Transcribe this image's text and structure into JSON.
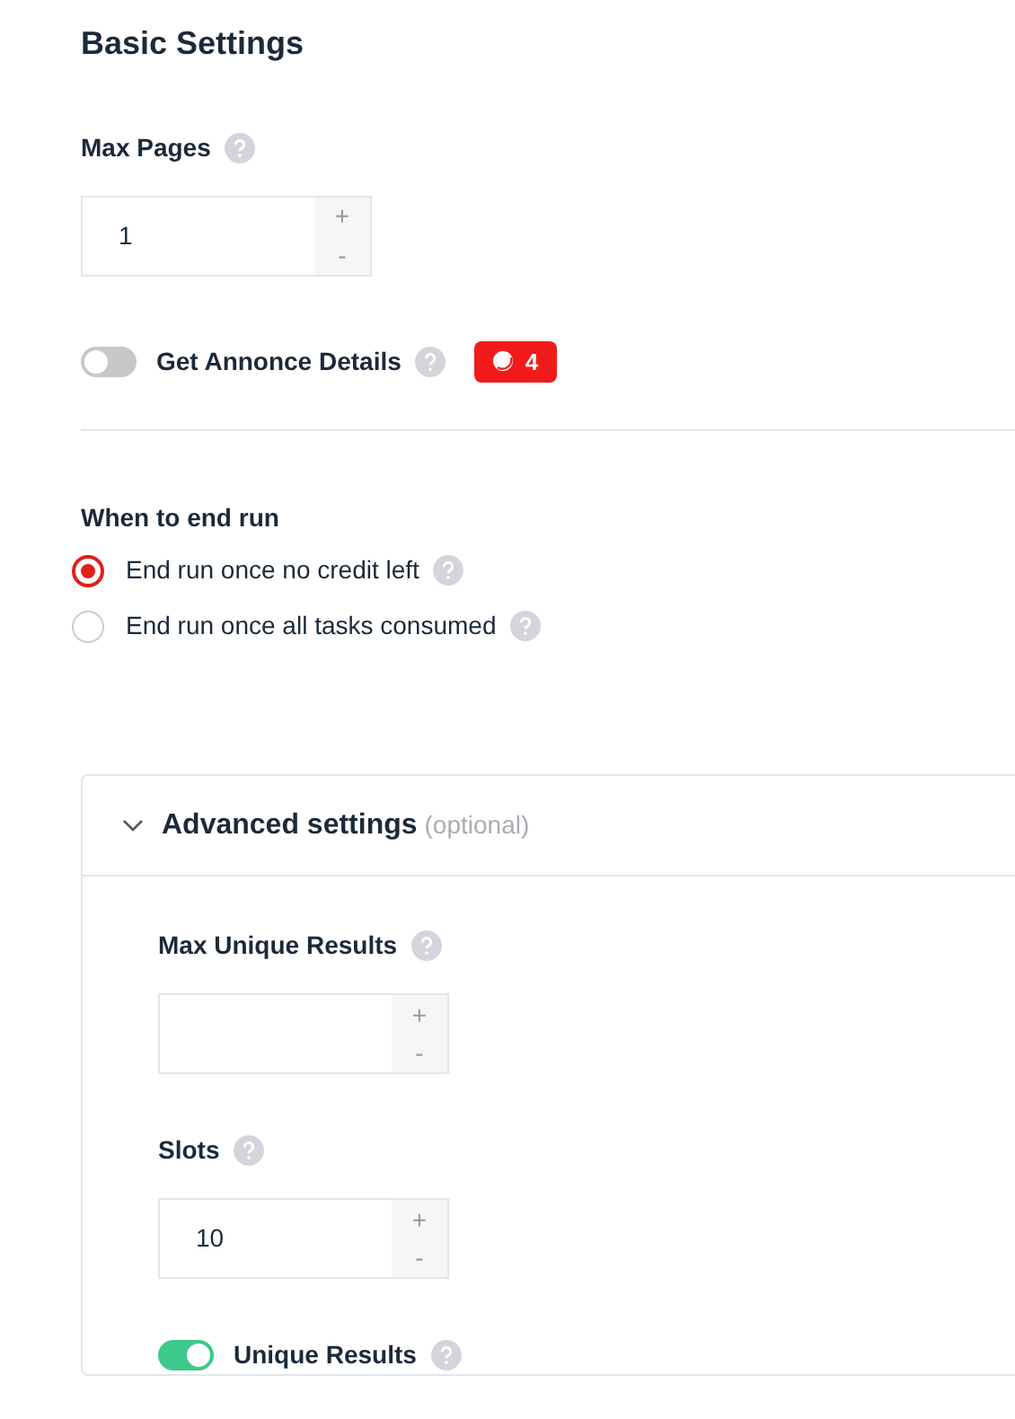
{
  "title": "Basic Settings",
  "basic": [
    {
      "kind": "number",
      "label": "Max Pages",
      "value": "1",
      "increment": "+",
      "decrement": "-"
    },
    {
      "kind": "toggle",
      "label": "Get Annonce Details",
      "on": false,
      "badge": "4"
    }
  ],
  "end_run": {
    "label": "When to end run",
    "options": [
      {
        "label": "End run once no credit left",
        "selected": true
      },
      {
        "label": "End run once all tasks consumed",
        "selected": false
      }
    ]
  },
  "advanced": {
    "title": "Advanced settings",
    "note": "(optional)",
    "expanded": true,
    "fields": [
      {
        "kind": "number",
        "label": "Max Unique Results",
        "increment": "+",
        "decrement": "-"
      },
      {
        "kind": "number",
        "label": "Slots",
        "value": "10",
        "increment": "+",
        "decrement": "-"
      },
      {
        "kind": "toggle",
        "label": "Unique Results",
        "on": true
      }
    ]
  }
}
